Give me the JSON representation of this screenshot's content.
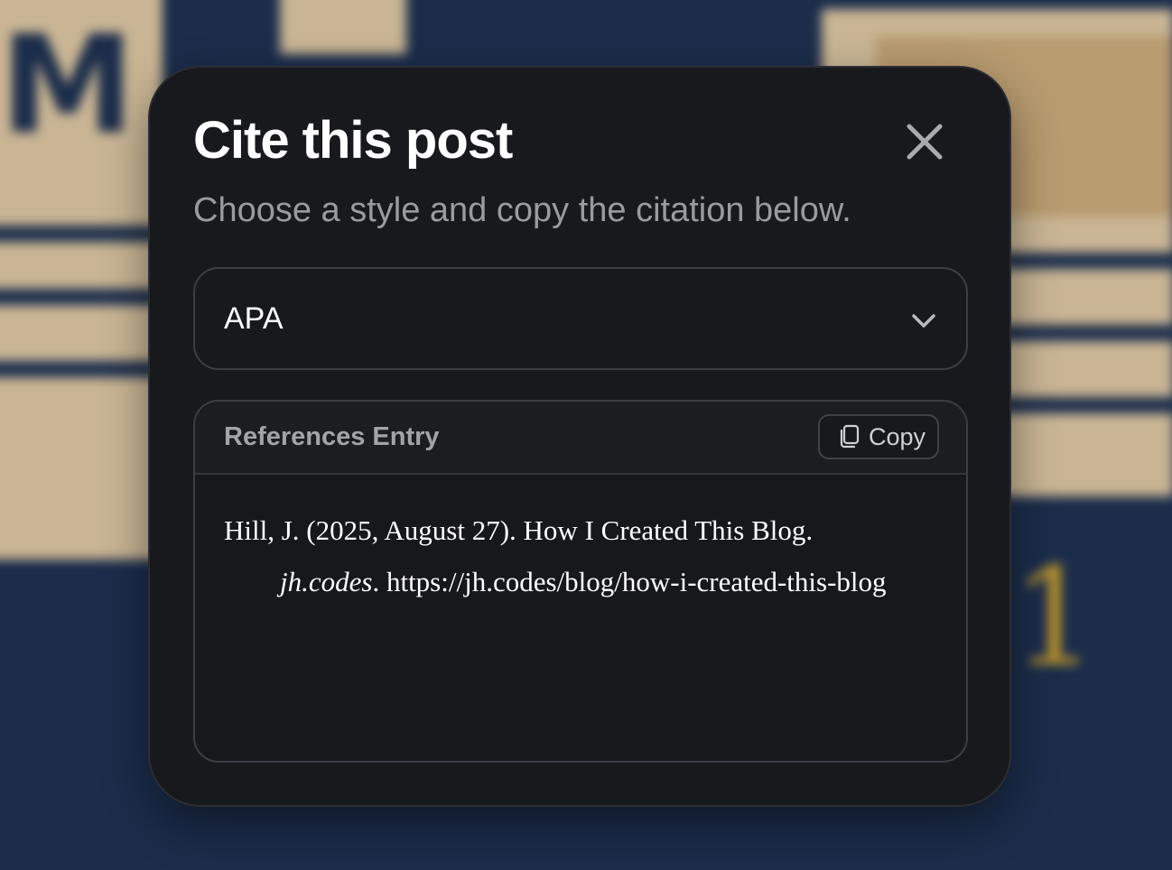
{
  "dialog": {
    "title": "Cite this post",
    "subtitle": "Choose a style and copy the citation below.",
    "close_icon": "close-icon"
  },
  "style_select": {
    "selected": "APA",
    "icon": "chevron-down-icon"
  },
  "citation": {
    "header": "References Entry",
    "copy_label": "Copy",
    "copy_icon": "copy-icon",
    "line1": "Hill, J. (2025, August 27). How I Created This Blog.",
    "source": "jh.codes",
    "source_sep": ". ",
    "url": "https://jh.codes/blog/how-i-created-this-blog"
  },
  "colors": {
    "modal_bg": "#18191d",
    "backdrop_navy": "#1b2d4b",
    "backdrop_beige": "#c9b594",
    "backdrop_gold": "#b8922e"
  }
}
